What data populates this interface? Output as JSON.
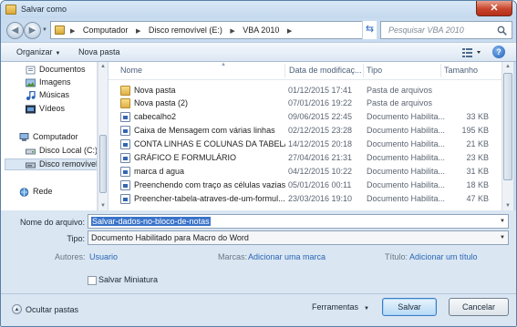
{
  "window": {
    "title": "Salvar como",
    "close_label": "✕"
  },
  "address": {
    "crumbs": [
      "Computador",
      "Disco removível (E:)",
      "VBA 2010"
    ],
    "search_placeholder": "Pesquisar VBA 2010"
  },
  "toolbar": {
    "organize_label": "Organizar",
    "new_folder_label": "Nova pasta",
    "help_label": "?"
  },
  "sidebar": {
    "items": [
      {
        "label": "Documentos",
        "icon": "documents-icon"
      },
      {
        "label": "Imagens",
        "icon": "pictures-icon"
      },
      {
        "label": "Músicas",
        "icon": "music-icon"
      },
      {
        "label": "Vídeos",
        "icon": "videos-icon"
      },
      {
        "label": "Computador",
        "icon": "computer-icon"
      },
      {
        "label": "Disco Local (C:)",
        "icon": "drive-icon"
      },
      {
        "label": "Disco removível (E",
        "icon": "removable-drive-icon",
        "selected": true
      },
      {
        "label": "Rede",
        "icon": "network-icon"
      }
    ]
  },
  "columns": {
    "name": "Nome",
    "date": "Data de modificaç...",
    "type": "Tipo",
    "size": "Tamanho"
  },
  "files": [
    {
      "name": "Nova pasta",
      "date": "01/12/2015 17:41",
      "type": "Pasta de arquivos",
      "size": "",
      "kind": "folder"
    },
    {
      "name": "Nova pasta (2)",
      "date": "07/01/2016 19:22",
      "type": "Pasta de arquivos",
      "size": "",
      "kind": "folder"
    },
    {
      "name": "cabecalho2",
      "date": "09/06/2015 22:45",
      "type": "Documento Habilita...",
      "size": "33 KB",
      "kind": "doc"
    },
    {
      "name": "Caixa de Mensagem  com várias linhas",
      "date": "02/12/2015 23:28",
      "type": "Documento Habilita...",
      "size": "195 KB",
      "kind": "doc"
    },
    {
      "name": "CONTA LINHAS E COLUNAS DA TABELA",
      "date": "14/12/2015 20:18",
      "type": "Documento Habilita...",
      "size": "21 KB",
      "kind": "doc"
    },
    {
      "name": "GRÁFICO E FORMULÁRIO",
      "date": "27/04/2016 21:31",
      "type": "Documento Habilita...",
      "size": "23 KB",
      "kind": "doc"
    },
    {
      "name": "marca d agua",
      "date": "04/12/2015 10:22",
      "type": "Documento Habilita...",
      "size": "31 KB",
      "kind": "doc"
    },
    {
      "name": "Preenchendo com traço as células vazias ...",
      "date": "05/01/2016 00:11",
      "type": "Documento Habilita...",
      "size": "18 KB",
      "kind": "doc"
    },
    {
      "name": "Preencher-tabela-atraves-de-um-formul...",
      "date": "23/03/2016 19:10",
      "type": "Documento Habilita...",
      "size": "47 KB",
      "kind": "doc"
    }
  ],
  "form": {
    "filename_label": "Nome do arquivo:",
    "filename_value": "Salvar-dados-no-bloco-de-notas",
    "type_label": "Tipo:",
    "type_value": "Documento Habilitado para Macro do Word",
    "authors_label": "Autores:",
    "authors_value": "Usuario",
    "tags_label": "Marcas:",
    "tags_value": "Adicionar uma marca",
    "title_label": "Título:",
    "title_value": "Adicionar um título",
    "thumbnail_label": "Salvar Miniatura"
  },
  "footer": {
    "hide_folders_label": "Ocultar pastas",
    "tools_label": "Ferramentas",
    "save_label": "Salvar",
    "cancel_label": "Cancelar"
  }
}
